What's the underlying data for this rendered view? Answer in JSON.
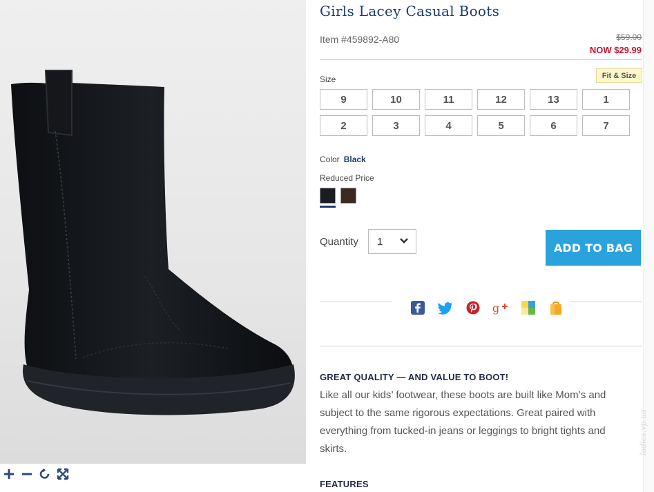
{
  "product": {
    "title": "Girls Lacey Casual Boots",
    "item_number": "Item #459892-A80",
    "was_price": "$59.00",
    "now_price": "NOW $29.99"
  },
  "image": {
    "alt": "black boot",
    "controls": [
      "zoom-in-icon",
      "zoom-out-icon",
      "rotate-icon",
      "fullscreen-icon"
    ]
  },
  "size": {
    "label": "Size",
    "fit_link": "Fit & Size",
    "options": [
      "9",
      "10",
      "11",
      "12",
      "13",
      "1",
      "2",
      "3",
      "4",
      "5",
      "6",
      "7"
    ]
  },
  "color": {
    "label": "Color",
    "selected": "Black",
    "group_label": "Reduced Price",
    "swatches": [
      {
        "name": "Black",
        "hex": "#1a1d22"
      },
      {
        "name": "Brown",
        "hex": "#3b2a22"
      }
    ]
  },
  "quantity": {
    "label": "Quantity",
    "value": "1"
  },
  "add_to_bag": "ADD TO BAG",
  "social": [
    "facebook-icon",
    "twitter-icon",
    "pinterest-icon",
    "google-plus-icon",
    "polyvore-icon",
    "shopping-bag-icon"
  ],
  "description": {
    "heading": "GREAT QUALITY — AND VALUE TO BOOT!",
    "body": "Like all our kids’ footwear, these boots are built like Mom’s and subject to the same rigorous expectations. Great paired with everything from tucked-in jeans or leggings to bright tights and skirts.",
    "features_heading": "FEATURES"
  },
  "watermark": "ladies.vp.ua",
  "colors": {
    "title_blue": "#1b3c6e",
    "sale_red": "#c8102e",
    "button_blue": "#2aa3dd",
    "fit_yellow": "#fff7c8"
  }
}
